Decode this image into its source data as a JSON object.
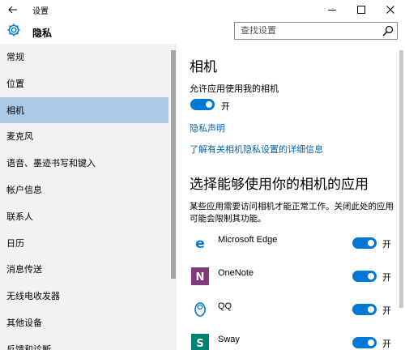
{
  "window": {
    "title": "设置",
    "minimize_icon": "minimize-icon",
    "maximize_icon": "maximize-icon",
    "close_icon": "close-icon"
  },
  "header": {
    "title": "隐私",
    "icon": "gear-icon"
  },
  "search": {
    "placeholder": "查找设置",
    "icon": "search-icon"
  },
  "sidebar": {
    "items": [
      {
        "label": "常规",
        "selected": false
      },
      {
        "label": "位置",
        "selected": false
      },
      {
        "label": "相机",
        "selected": true
      },
      {
        "label": "麦克风",
        "selected": false
      },
      {
        "label": "语音、墨迹书写和键入",
        "selected": false
      },
      {
        "label": "帐户信息",
        "selected": false
      },
      {
        "label": "联系人",
        "selected": false
      },
      {
        "label": "日历",
        "selected": false
      },
      {
        "label": "消息传送",
        "selected": false
      },
      {
        "label": "无线电收发器",
        "selected": false
      },
      {
        "label": "其他设备",
        "selected": false
      },
      {
        "label": "反馈和诊断",
        "selected": false
      }
    ]
  },
  "main": {
    "title": "相机",
    "allow_label": "允许应用使用我的相机",
    "allow_state": "开",
    "privacy_link": "隐私声明",
    "details_link": "了解有关相机隐私设置的详细信息",
    "apps_title": "选择能够使用你的相机的应用",
    "apps_desc": "某些应用需要访问相机才能正常工作。关闭此处的应用可能会限制其功能。",
    "apps": [
      {
        "name": "Microsoft Edge",
        "state": "开",
        "icon": "edge-icon",
        "color": "#0078d7"
      },
      {
        "name": "OneNote",
        "state": "开",
        "icon": "onenote-icon",
        "color": "#80397b"
      },
      {
        "name": "QQ",
        "state": "开",
        "icon": "qq-icon",
        "color": "#0078d7"
      },
      {
        "name": "Sway",
        "state": "开",
        "icon": "sway-icon",
        "color": "#008272"
      }
    ]
  },
  "colors": {
    "accent": "#0078d7",
    "selected_nav": "#acc9e6",
    "link": "#0063b1",
    "sidebar_bg": "#f2f2f2"
  }
}
